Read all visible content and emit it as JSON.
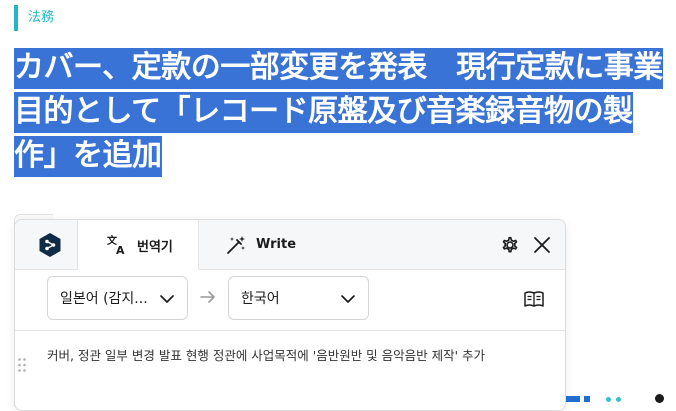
{
  "article": {
    "category": "法務",
    "headline": "カバー、定款の一部変更を発表　現行定款に事業目的として「レコード原盤及び音楽録音物の製作」を追加"
  },
  "translator": {
    "tabs": [
      {
        "label": "번역기",
        "icon": "translate-icon",
        "active": true
      },
      {
        "label": "Write",
        "icon": "magic-wand-icon",
        "active": false
      }
    ],
    "source_language": "일본어 (감지...",
    "target_language": "한국어",
    "translation_text": "커버, 정관 일부 변경 발표 현행 정관에 사업목적에 '음반원반 및 음악음반 제작' 추가"
  },
  "colors": {
    "accent_teal": "#21b7c5",
    "selection_blue": "#3a73d6",
    "deepl_navy": "#0f2b46"
  }
}
